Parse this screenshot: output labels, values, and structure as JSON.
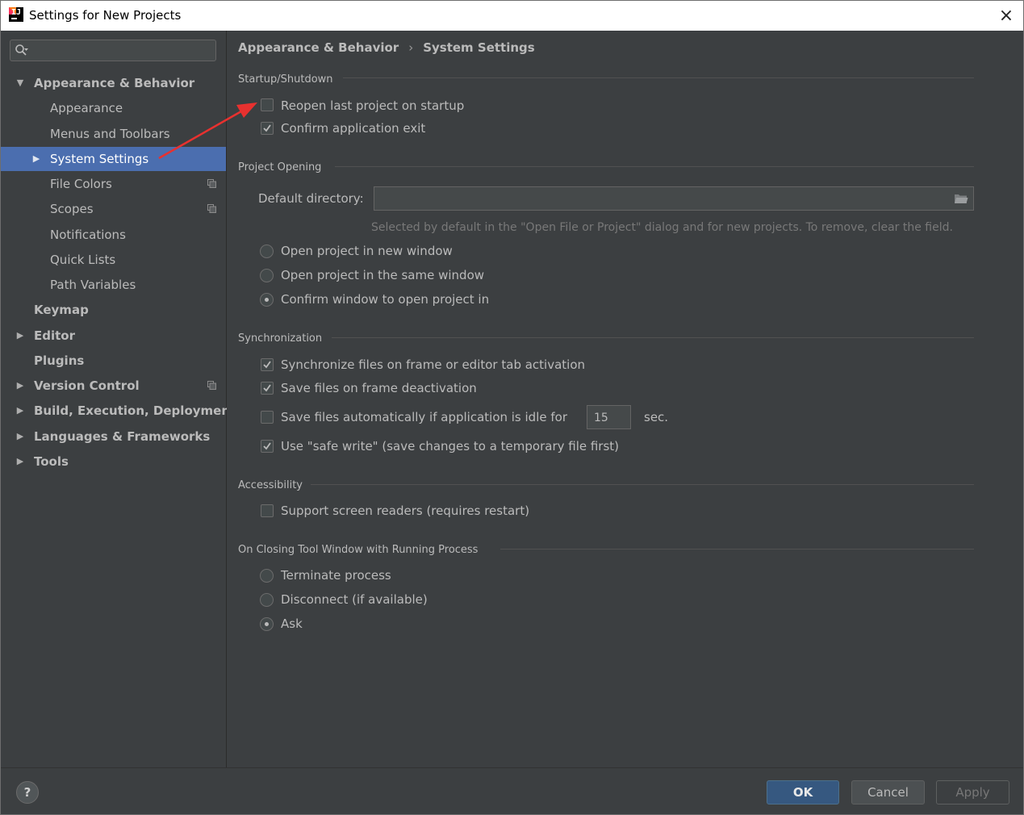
{
  "window": {
    "title": "Settings for New Projects",
    "close_glyph": "×"
  },
  "search": {
    "value": "",
    "placeholder": ""
  },
  "tree": {
    "items": [
      {
        "label": "Appearance & Behavior",
        "arrow": "▼"
      },
      {
        "label": "Appearance"
      },
      {
        "label": "Menus and Toolbars"
      },
      {
        "label": "System Settings",
        "arrow": "▶"
      },
      {
        "label": "File Colors"
      },
      {
        "label": "Scopes"
      },
      {
        "label": "Notifications"
      },
      {
        "label": "Quick Lists"
      },
      {
        "label": "Path Variables"
      },
      {
        "label": "Keymap"
      },
      {
        "label": "Editor",
        "arrow": "▶"
      },
      {
        "label": "Plugins"
      },
      {
        "label": "Version Control",
        "arrow": "▶"
      },
      {
        "label": "Build, Execution, Deployment",
        "arrow": "▶"
      },
      {
        "label": "Languages & Frameworks",
        "arrow": "▶"
      },
      {
        "label": "Tools",
        "arrow": "▶"
      }
    ],
    "selected": "System Settings"
  },
  "breadcrumb": {
    "parent": "Appearance & Behavior",
    "separator": "›",
    "current": "System Settings"
  },
  "startup": {
    "header": "Startup/Shutdown",
    "reopen_label": "Reopen last project on startup",
    "reopen_checked": false,
    "confirm_exit_label": "Confirm application exit",
    "confirm_exit_checked": true
  },
  "project_opening": {
    "header": "Project Opening",
    "default_dir_label": "Default directory:",
    "default_dir_value": "",
    "hint": "Selected by default in the \"Open File or Project\" dialog and for new projects. To remove, clear the field.",
    "options": [
      "Open project in new window",
      "Open project in the same window",
      "Confirm window to open project in"
    ],
    "selected_option": "Confirm window to open project in"
  },
  "synchronization": {
    "header": "Synchronization",
    "sync_label": "Synchronize files on frame or editor tab activation",
    "sync_checked": true,
    "save_deactivation_label": "Save files on frame deactivation",
    "save_deactivation_checked": true,
    "save_idle_label": "Save files automatically if application is idle for",
    "save_idle_checked": false,
    "idle_value": "15",
    "idle_unit": "sec.",
    "safe_write_label": "Use \"safe write\" (save changes to a temporary file first)",
    "safe_write_checked": true
  },
  "accessibility": {
    "header": "Accessibility",
    "screen_readers_label": "Support screen readers (requires restart)",
    "screen_readers_checked": false
  },
  "closing": {
    "header": "On Closing Tool Window with Running Process",
    "options": [
      "Terminate process",
      "Disconnect (if available)",
      "Ask"
    ],
    "selected_option": "Ask"
  },
  "footer": {
    "help": "?",
    "ok": "OK",
    "cancel": "Cancel",
    "apply": "Apply"
  },
  "colors": {
    "background": "#3c3f41",
    "selection": "#4b6eaf",
    "annotation_arrow": "#e8312f",
    "ok_button": "#365880"
  }
}
